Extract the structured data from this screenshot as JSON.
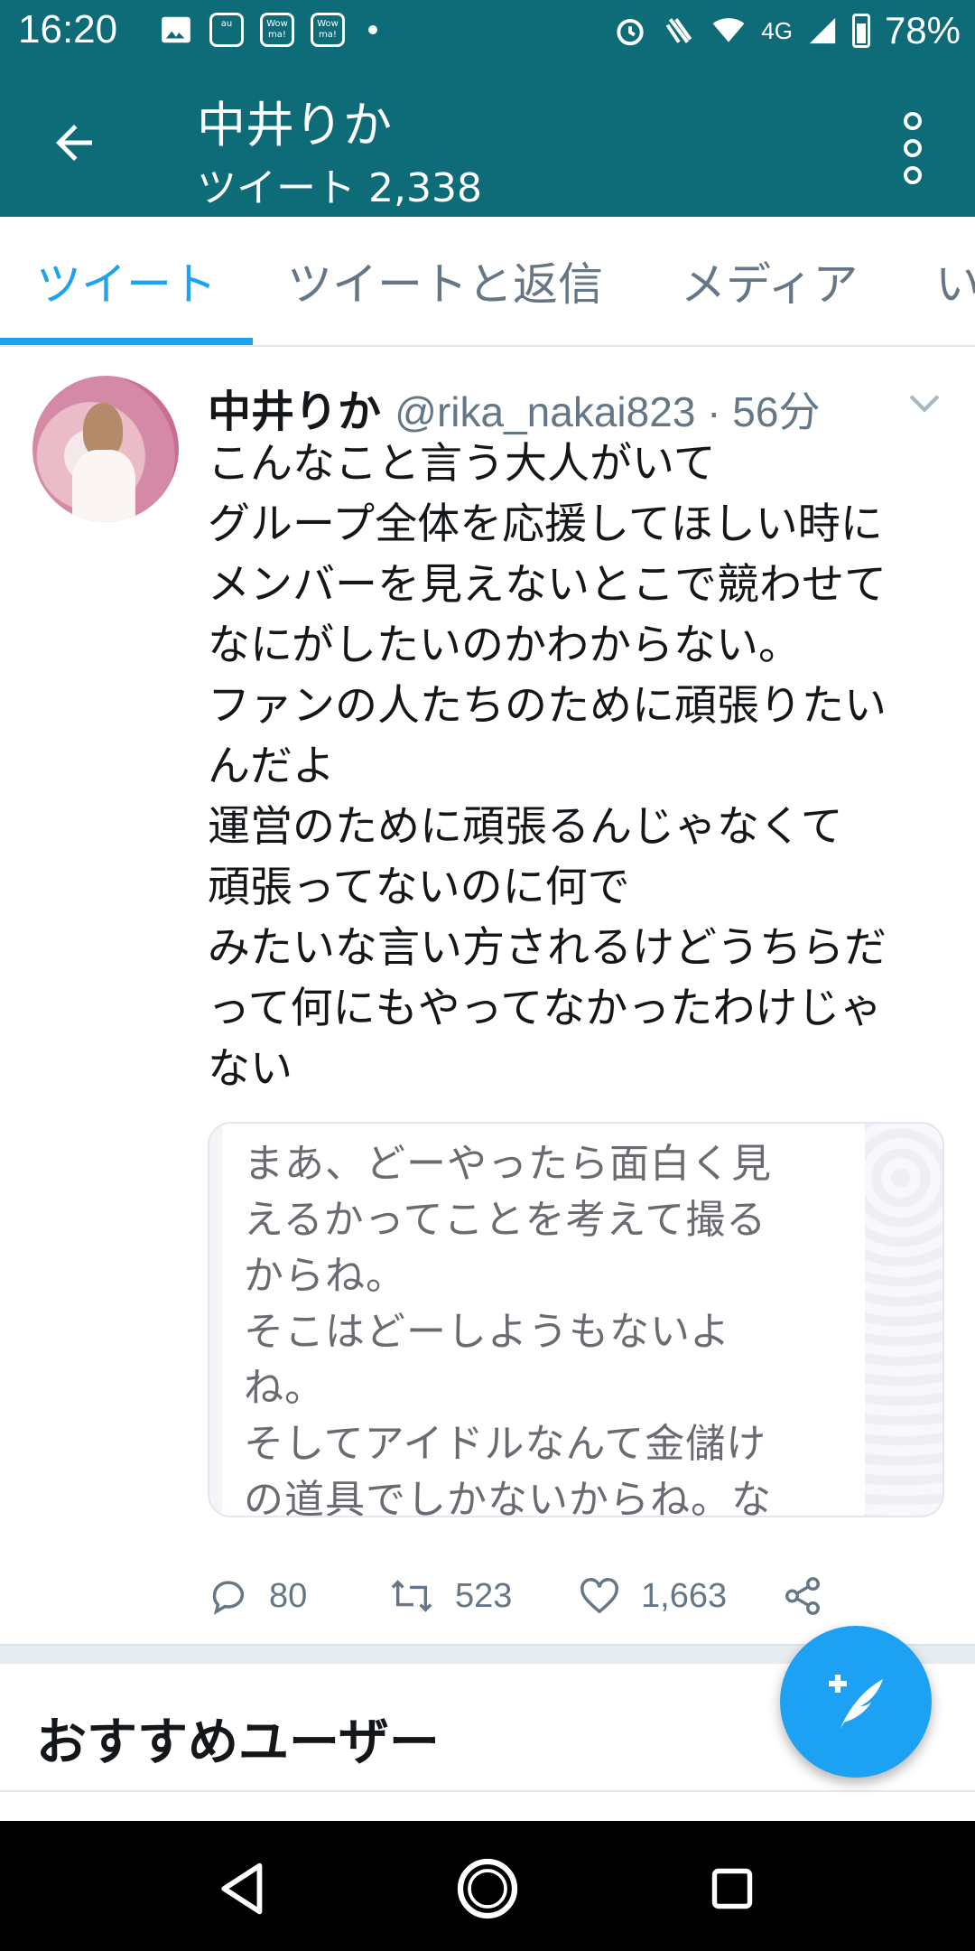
{
  "status_bar": {
    "time": "16:20",
    "notif_icons": [
      "image-icon",
      "au-mail-icon",
      "wowma-icon",
      "wowma-icon"
    ],
    "notif_labels": [
      "au",
      "Wow ma!",
      "Wow ma!"
    ],
    "network": "4G",
    "battery": "78%"
  },
  "app_bar": {
    "title": "中井りか",
    "subtitle": "ツイート 2,338"
  },
  "tabs": [
    "ツイート",
    "ツイートと返信",
    "メディア",
    "い"
  ],
  "tweet": {
    "name": "中井りか",
    "handle_time": "@rika_nakai823 · 56分",
    "body": "こんなこと言う大人がいて\nグループ全体を応援してほしい時に\nメンバーを見えないとこで競わせて\nなにがしたいのかわからない。\nファンの人たちのために頑張りたい\nんだよ\n運営のために頑張るんじゃなくて\n頑張ってないのに何で\nみたいな言い方されるけどうちらだ\nって何にもやってなかったわけじゃ\nない",
    "media_text": "まあ、どーやったら面白く見\nえるかってことを考えて撮る\nからね。\nそこはどーしようもないよ\nね。\nそしてアイドルなんて金儲け\nの道具でしかないからね。な",
    "reply_count": "80",
    "retweet_count": "523",
    "like_count": "1,663"
  },
  "recommend": {
    "title": "おすすめユーザー"
  },
  "colors": {
    "header": "#0e6b78",
    "accent": "#1da1f2",
    "secondary_text": "#657786"
  }
}
